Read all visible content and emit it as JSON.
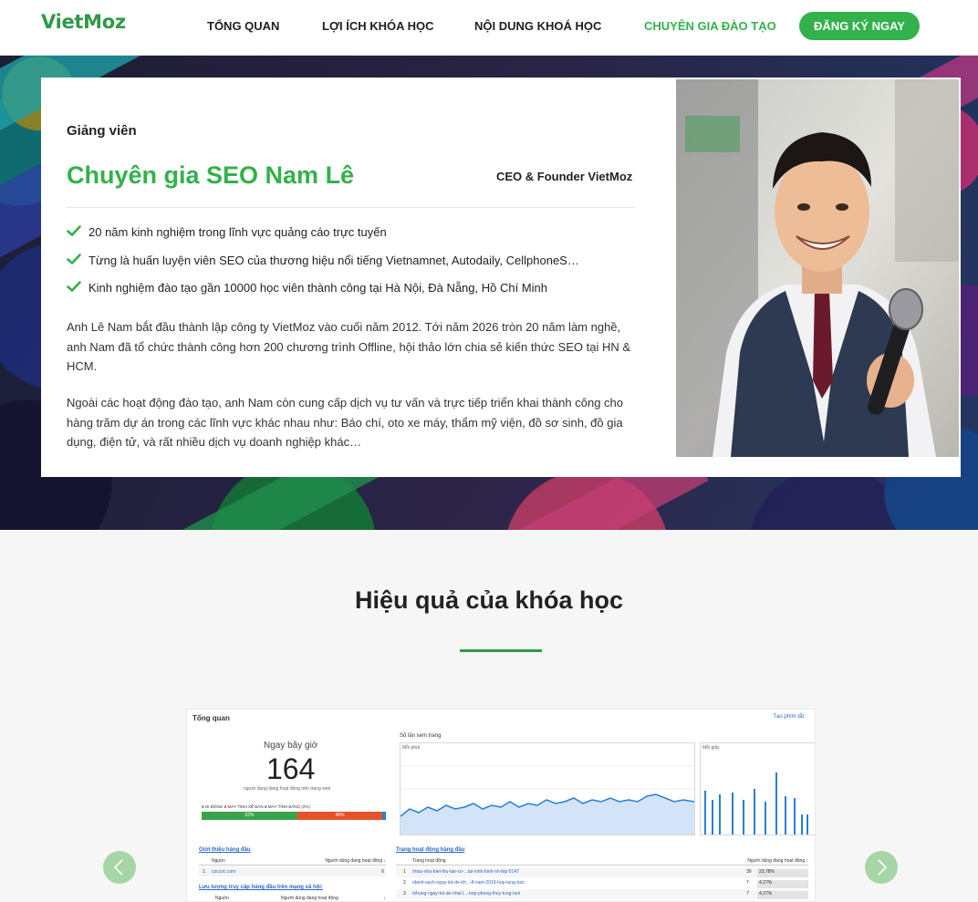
{
  "header": {
    "logo": "VietMoz",
    "nav": [
      "TỔNG QUAN",
      "LỢI ÍCH KHÓA HỌC",
      "NỘI DUNG KHOÁ HỌC",
      "CHUYÊN GIA ĐÀO TẠO"
    ],
    "active_index": 3,
    "cta": "ĐĂNG KÝ NGAY",
    "accent": "#33b14a"
  },
  "instructor": {
    "subtitle": "Giảng viên",
    "name": "Chuyên gia SEO Nam Lê",
    "role": "CEO & Founder VietMoz",
    "bullets": [
      "20 năm kinh nghiệm trong lĩnh vực quảng cáo trực tuyến",
      "Từng là huấn luyện viên SEO của thương hiệu nổi tiếng Vietnamnet, Autodaily, CellphoneS…",
      "Kinh nghiệm đào tạo gần 10000 học viên thành công tại Hà Nội, Đà Nẵng, Hồ Chí Minh"
    ],
    "para1": "Anh Lê Nam bắt đầu thành lập công ty VietMoz vào cuối năm 2012. Tới năm 2026 tròn 20 năm làm nghề, anh Nam đã tổ chức thành công hơn 200 chương trình Offline, hội thảo lớn chia sẻ kiến thức SEO tại HN & HCM.",
    "para2": "Ngoài các hoạt động đào tạo, anh Nam còn cung cấp dịch vụ tư vấn và trực tiếp triển khai thành công cho hàng trăm dự án trong các lĩnh vực khác nhau như: Báo chí, oto xe máy, thẩm mỹ viện, đồ sơ sinh, đồ gia dụng, điện tử, và rất nhiều dịch vụ doanh nghiệp khác…"
  },
  "results": {
    "title": "Hiệu quả của khóa học",
    "prev_icon": "chevron-left-icon",
    "next_icon": "chevron-right-icon",
    "dashboard": {
      "header": "Tổng quan",
      "shortcut": "Tạo phím tắt",
      "realtime_label": "Ngay bây giờ",
      "realtime_value": "164",
      "realtime_sub": "người dùng đang hoạt động trên trang web",
      "device_legend": [
        "DI ĐỘNG",
        "MÁY TÍNH XỂ BÀN",
        "MÁY TÍNH BẢNG (2%)"
      ],
      "device_values": [
        "52%",
        "46%"
      ],
      "pageviews_title": "Số lần xem trang",
      "per_minute": "Mỗi phút",
      "per_second": "Mỗi giây",
      "referrals_title": "Giới thiệu hàng đầu",
      "referrals_cols": [
        "Nguồn",
        "Người dùng đang hoạt động ↓"
      ],
      "referrals_rows": [
        [
          "1.",
          "coccoc.com",
          "6"
        ]
      ],
      "social_title": "Lưu lượng truy cập hàng đầu trên mạng xã hội:",
      "social_cols": [
        "Nguồn",
        "Người dùng đang hoạt động",
        "↓"
      ],
      "pages_title": "Trang hoạt động hàng đầu",
      "pages_cols": [
        "Trang hoạt động",
        "Người dùng đang hoạt động ↓"
      ],
      "pages_rows": [
        [
          "1",
          "/mau-nha-biet-thu-tan-co-...tai-ninh-binh-nh-btp-5147",
          "39",
          "23,78%"
        ],
        [
          "2",
          "/danh-sach-ngay-tot-de-kh...-8-nam-2019-hop-tung-tuoi",
          "7",
          "4,27%"
        ],
        [
          "3",
          "/nhung-ngay-tot-de-nhai-l...-hop-phong-thuy-tung-tuoi",
          "7",
          "4,27%"
        ]
      ]
    }
  }
}
